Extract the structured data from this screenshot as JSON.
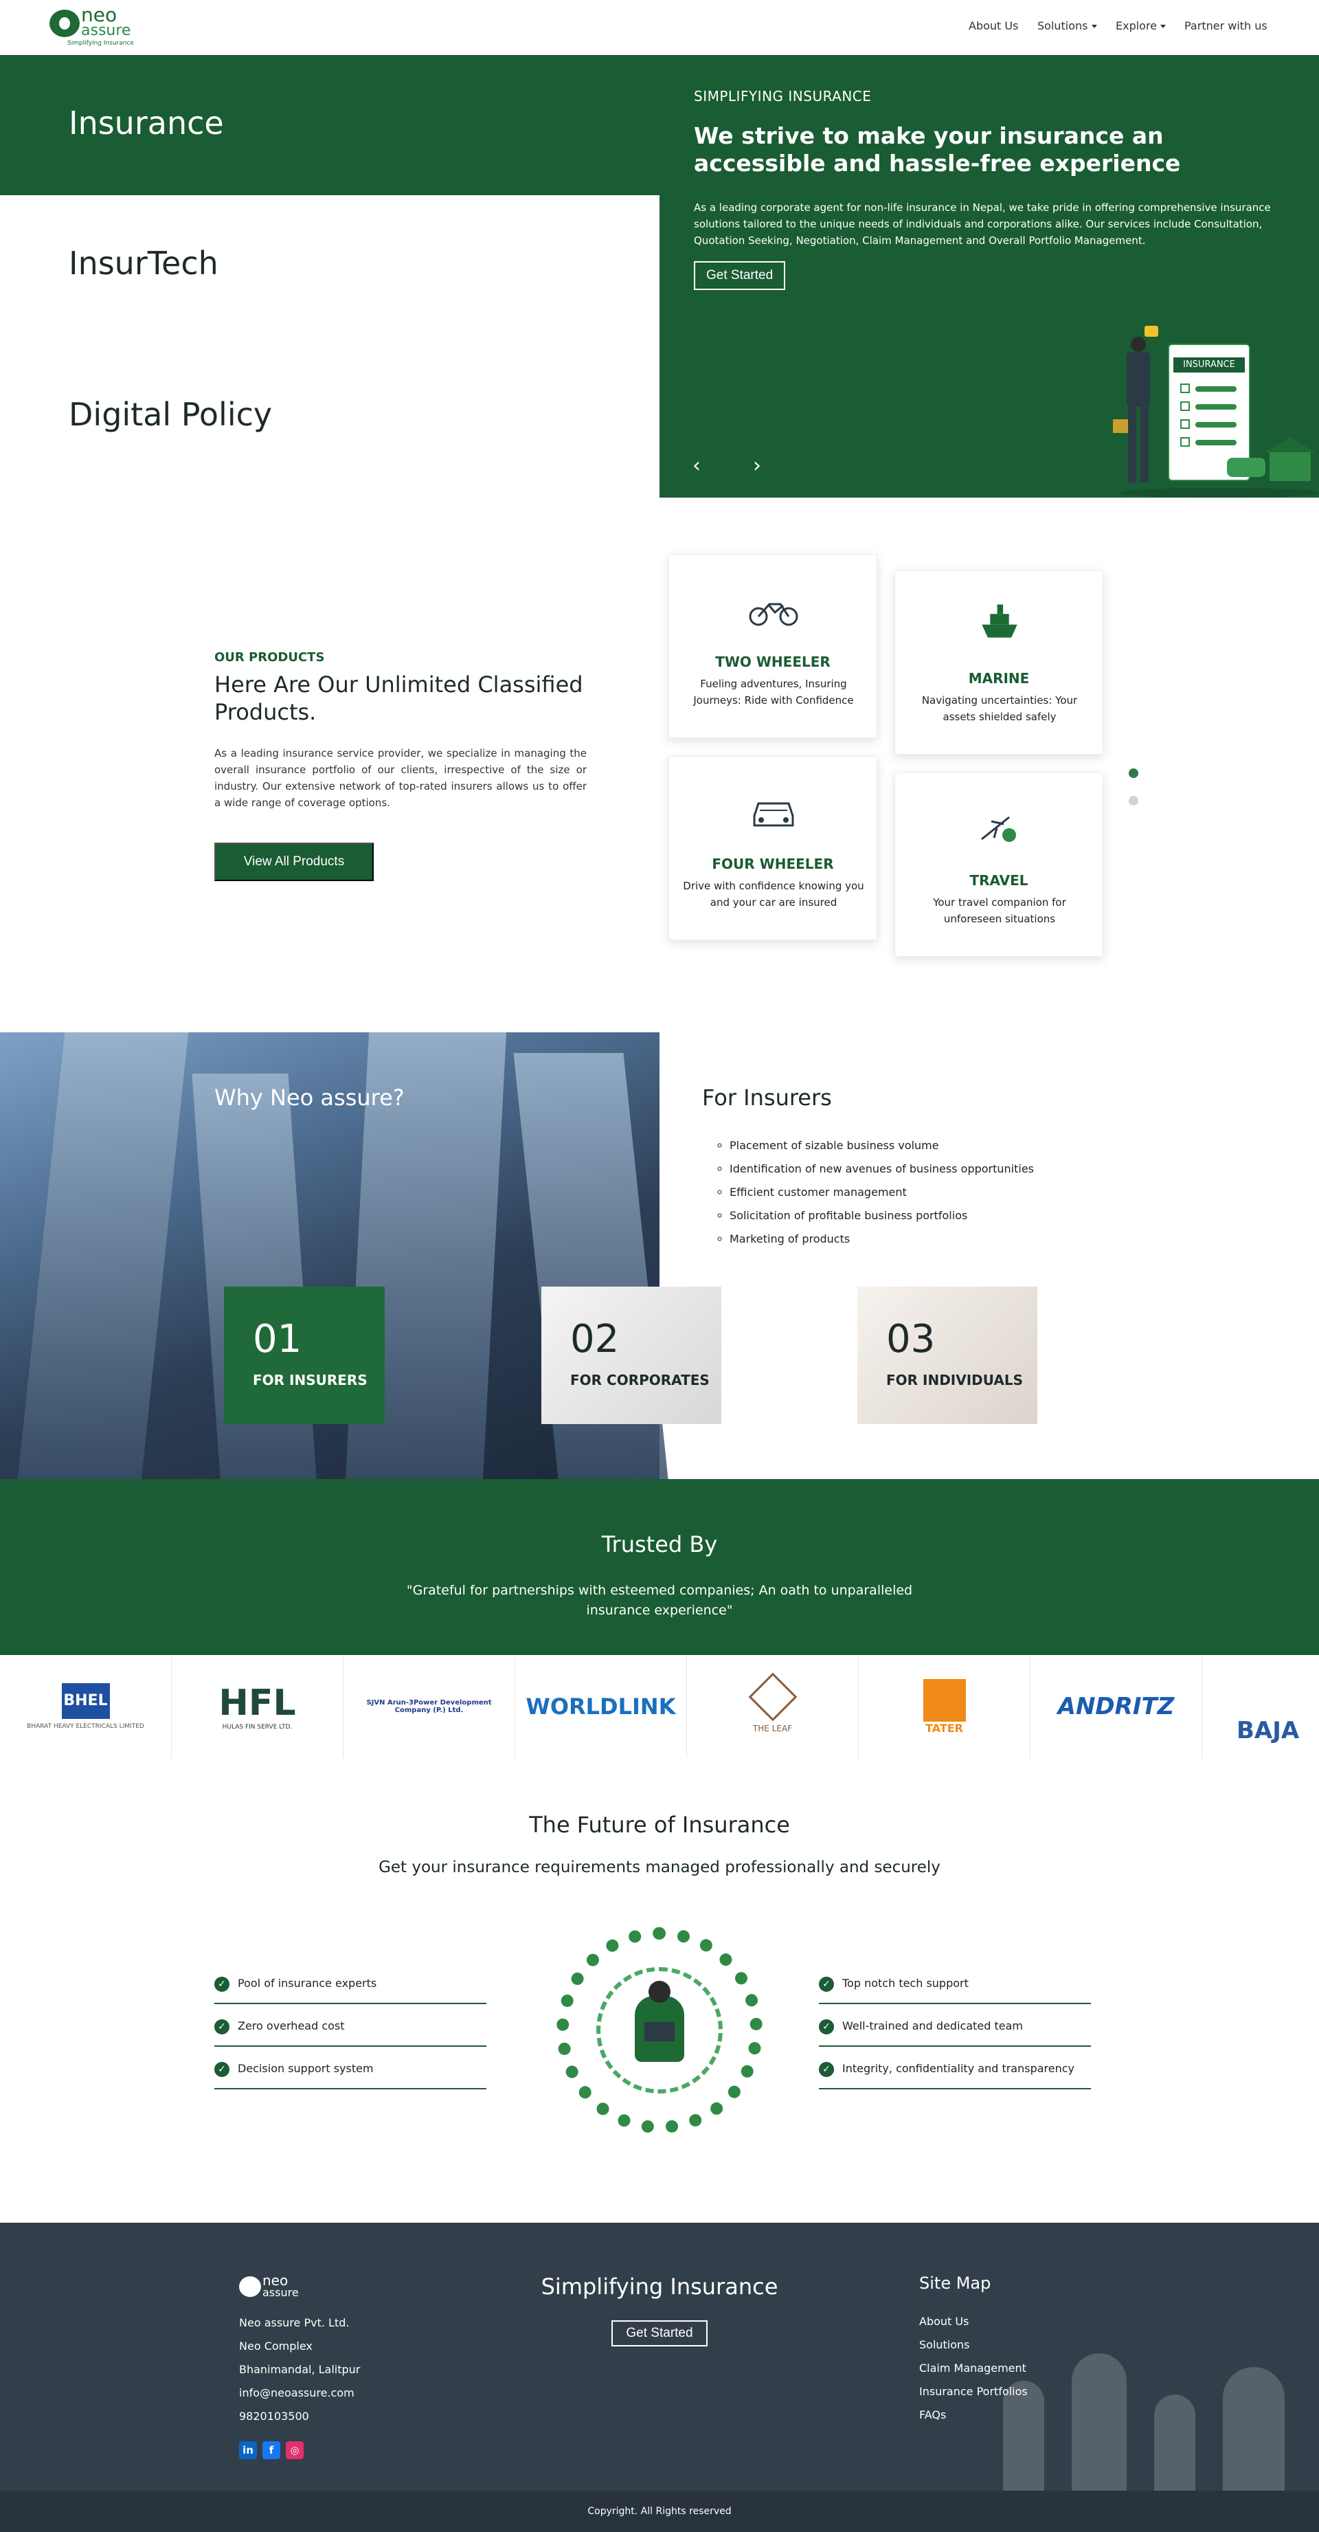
{
  "header": {
    "logo": {
      "neo": "neo",
      "assure": "assure",
      "tagline": "Simplifying Insurance"
    },
    "nav": [
      {
        "label": "About Us",
        "dropdown": false
      },
      {
        "label": "Solutions",
        "dropdown": true
      },
      {
        "label": "Explore",
        "dropdown": true
      },
      {
        "label": "Partner with us",
        "dropdown": false
      }
    ]
  },
  "hero": {
    "tabs": [
      "Insurance",
      "InsurTech",
      "Digital Policy"
    ],
    "active_tab": "Insurance",
    "kicker": "SIMPLIFYING INSURANCE",
    "heading": "We strive to make your insurance an accessible and hassle-free experience",
    "text": "As a leading corporate agent for non-life insurance in Nepal, we take pride in offering comprehensive insurance solutions tailored to the unique needs of individuals and corporations alike. Our services include Consultation, Quotation Seeking, Negotiation, Claim Management and Overall Portfolio Management.",
    "cta": "Get Started",
    "illustration_label": "INSURANCE",
    "prev_icon": "chevron-left-icon",
    "next_icon": "chevron-right-icon"
  },
  "products": {
    "kicker": "OUR PRODUCTS",
    "heading": "Here Are Our Unlimited Classified Products.",
    "text": "As a leading insurance service provider, we specialize in managing the overall insurance portfolio of our clients, irrespective of the size or industry. Our extensive network of top-rated insurers allows us to offer a wide range of coverage options.",
    "cta": "View All Products",
    "cards": [
      {
        "title": "TWO WHEELER",
        "desc": "Fueling adventures, Insuring Journeys: Ride with Confidence",
        "icon": "motorcycle-icon"
      },
      {
        "title": "MARINE",
        "desc": "Navigating uncertainties: Your assets shielded safely",
        "icon": "ship-icon"
      },
      {
        "title": "FOUR WHEELER",
        "desc": "Drive with confidence knowing you and your car are insured",
        "icon": "car-icon"
      },
      {
        "title": "TRAVEL",
        "desc": "Your travel companion for unforeseen situations",
        "icon": "airplane-icon"
      }
    ]
  },
  "why": {
    "title": "Why Neo assure?",
    "panel_title": "For Insurers",
    "bullets": [
      "Placement of sizable business volume",
      "Identification of new avenues of business opportunities",
      "Efficient customer management",
      "Solicitation of profitable business portfolios",
      "Marketing of products"
    ],
    "boxes": [
      {
        "num": "01",
        "label": "FOR INSURERS"
      },
      {
        "num": "02",
        "label": "FOR CORPORATES"
      },
      {
        "num": "03",
        "label": "FOR INDIVIDUALS"
      }
    ]
  },
  "trusted": {
    "title": "Trusted By",
    "quote": "\"Grateful for partnerships with esteemed companies; An oath to unparalleled insurance experience\"",
    "logos": [
      {
        "name": "BHEL",
        "text": "BHARAT HEAVY ELECTRICALS LIMITED",
        "color": "#1f4fa0"
      },
      {
        "name": "HFL",
        "text": "HULAS FIN SERVE LTD.",
        "color": "#1f4a3a"
      },
      {
        "name": "SJVN Arun-3Power Development Company (P.) Ltd.",
        "text": "",
        "color": "#1f3c88"
      },
      {
        "name": "WORLDLINK",
        "text": "",
        "color": "#1a6fc0"
      },
      {
        "name": "THE LEAF",
        "text": "",
        "color": "#8a5a3a"
      },
      {
        "name": "TATER",
        "text": "",
        "color": "#f08a18"
      },
      {
        "name": "ANDRITZ",
        "text": "",
        "color": "#1a5cb0"
      },
      {
        "name": "BAJA",
        "text": "",
        "color": "#2a5aa0"
      }
    ]
  },
  "future": {
    "title": "The Future of Insurance",
    "subtitle": "Get your insurance requirements managed professionally and securely",
    "left": [
      "Pool of insurance experts",
      "Zero overhead cost",
      "Decision support system"
    ],
    "right": [
      "Top notch tech support",
      "Well-trained and dedicated team",
      "Integrity, confidentiality and transparency"
    ]
  },
  "footer": {
    "logo": {
      "neo": "neo",
      "assure": "assure"
    },
    "company": "Neo assure Pvt. Ltd.",
    "address1": "Neo Complex",
    "address2": "Bhanimandal, Lalitpur",
    "email": "info@neoassure.com",
    "phone": "9820103500",
    "social": [
      {
        "icon": "linkedin-icon",
        "glyph": "in",
        "color": "#0a66c2"
      },
      {
        "icon": "facebook-icon",
        "glyph": "f",
        "color": "#1877f2"
      },
      {
        "icon": "instagram-icon",
        "glyph": "◎",
        "color": "#e1306c"
      }
    ],
    "center_title": "Simplifying Insurance",
    "center_cta": "Get Started",
    "sitemap_title": "Site Map",
    "sitemap": [
      "About Us",
      "Solutions",
      "Claim Management",
      "Insurance Portfolios",
      "FAQs"
    ],
    "copyright": "Copyright. All Rights reserved"
  },
  "colors": {
    "brand": "#1a5c33",
    "footer": "#323f4a"
  }
}
